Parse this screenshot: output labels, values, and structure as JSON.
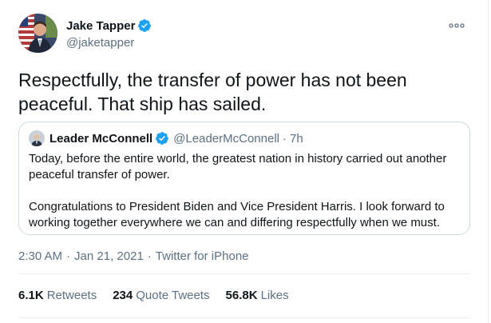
{
  "tweet": {
    "author": {
      "display_name": "Jake Tapper",
      "handle": "@jaketapper",
      "verified": true,
      "avatar_icon": "profile-photo"
    },
    "text": "Respectfully, the transfer of power has not been peaceful. That ship has sailed.",
    "more_icon": "more-options-icon"
  },
  "quoted_tweet": {
    "author": {
      "display_name": "Leader McConnell",
      "handle": "@LeaderMcConnell",
      "verified": true
    },
    "separator": "·",
    "time": "7h",
    "paragraphs": [
      "Today, before the entire world, the greatest nation in history carried out another peaceful transfer of power.",
      "Congratulations to President Biden and Vice President Harris. I look forward to working together everywhere we can and differing respectfully when we must."
    ]
  },
  "meta": {
    "time": "2:30 AM",
    "separator": "·",
    "date": "Jan 21, 2021",
    "source": "Twitter for iPhone"
  },
  "stats": {
    "retweets_count": "6.1K",
    "retweets_label": "Retweets",
    "quotes_count": "234",
    "quotes_label": "Quote Tweets",
    "likes_count": "56.8K",
    "likes_label": "Likes"
  },
  "colors": {
    "verified_blue": "#1da1f2",
    "secondary_text": "#5b7083",
    "border": "#cfd9de"
  }
}
